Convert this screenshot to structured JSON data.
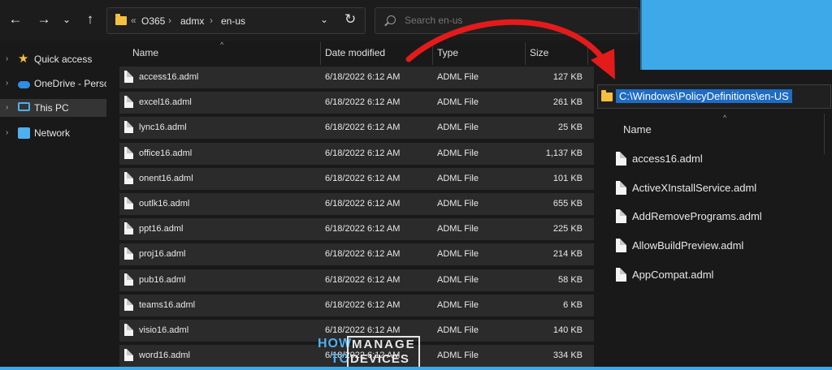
{
  "explorer": {
    "address": {
      "overflow": "«",
      "segments": [
        "O365",
        "admx",
        "en-us"
      ],
      "separator": "›"
    },
    "search": {
      "placeholder": "Search en-us"
    },
    "nav_pane": [
      {
        "label": "Quick access",
        "icon": "star-icon"
      },
      {
        "label": "OneDrive - Person",
        "icon": "cloud-icon"
      },
      {
        "label": "This PC",
        "icon": "computer-icon",
        "selected": true
      },
      {
        "label": "Network",
        "icon": "network-icon"
      }
    ],
    "columns": {
      "name": "Name",
      "date": "Date modified",
      "type": "Type",
      "size": "Size"
    },
    "files": [
      {
        "name": "access16.adml",
        "date": "6/18/2022 6:12 AM",
        "type": "ADML File",
        "size": "127 KB"
      },
      {
        "name": "excel16.adml",
        "date": "6/18/2022 6:12 AM",
        "type": "ADML File",
        "size": "261 KB"
      },
      {
        "name": "lync16.adml",
        "date": "6/18/2022 6:12 AM",
        "type": "ADML File",
        "size": "25 KB"
      },
      {
        "name": "office16.adml",
        "date": "6/18/2022 6:12 AM",
        "type": "ADML File",
        "size": "1,137 KB"
      },
      {
        "name": "onent16.adml",
        "date": "6/18/2022 6:12 AM",
        "type": "ADML File",
        "size": "101 KB"
      },
      {
        "name": "outlk16.adml",
        "date": "6/18/2022 6:12 AM",
        "type": "ADML File",
        "size": "655 KB"
      },
      {
        "name": "ppt16.adml",
        "date": "6/18/2022 6:12 AM",
        "type": "ADML File",
        "size": "225 KB"
      },
      {
        "name": "proj16.adml",
        "date": "6/18/2022 6:12 AM",
        "type": "ADML File",
        "size": "214 KB"
      },
      {
        "name": "pub16.adml",
        "date": "6/18/2022 6:12 AM",
        "type": "ADML File",
        "size": "58 KB"
      },
      {
        "name": "teams16.adml",
        "date": "6/18/2022 6:12 AM",
        "type": "ADML File",
        "size": "6 KB"
      },
      {
        "name": "visio16.adml",
        "date": "6/18/2022 6:12 AM",
        "type": "ADML File",
        "size": "140 KB"
      },
      {
        "name": "word16.adml",
        "date": "6/18/2022 6:12 AM",
        "type": "ADML File",
        "size": "334 KB"
      }
    ]
  },
  "watermark": {
    "line1": "HOW",
    "line2": "TO",
    "brand1": "MANAGE",
    "brand2": "DEVICES"
  },
  "target_window": {
    "path": "C:\\Windows\\PolicyDefinitions\\en-US",
    "column_name": "Name",
    "files": [
      "access16.adml",
      "ActiveXInstallService.adml",
      "AddRemovePrograms.adml",
      "AllowBuildPreview.adml",
      "AppCompat.adml"
    ]
  },
  "colors": {
    "background": "#3da9e8",
    "window": "#191919",
    "row": "#2b2b2b",
    "arrow": "#e31b1b",
    "path_highlight": "#1e6cc4"
  }
}
